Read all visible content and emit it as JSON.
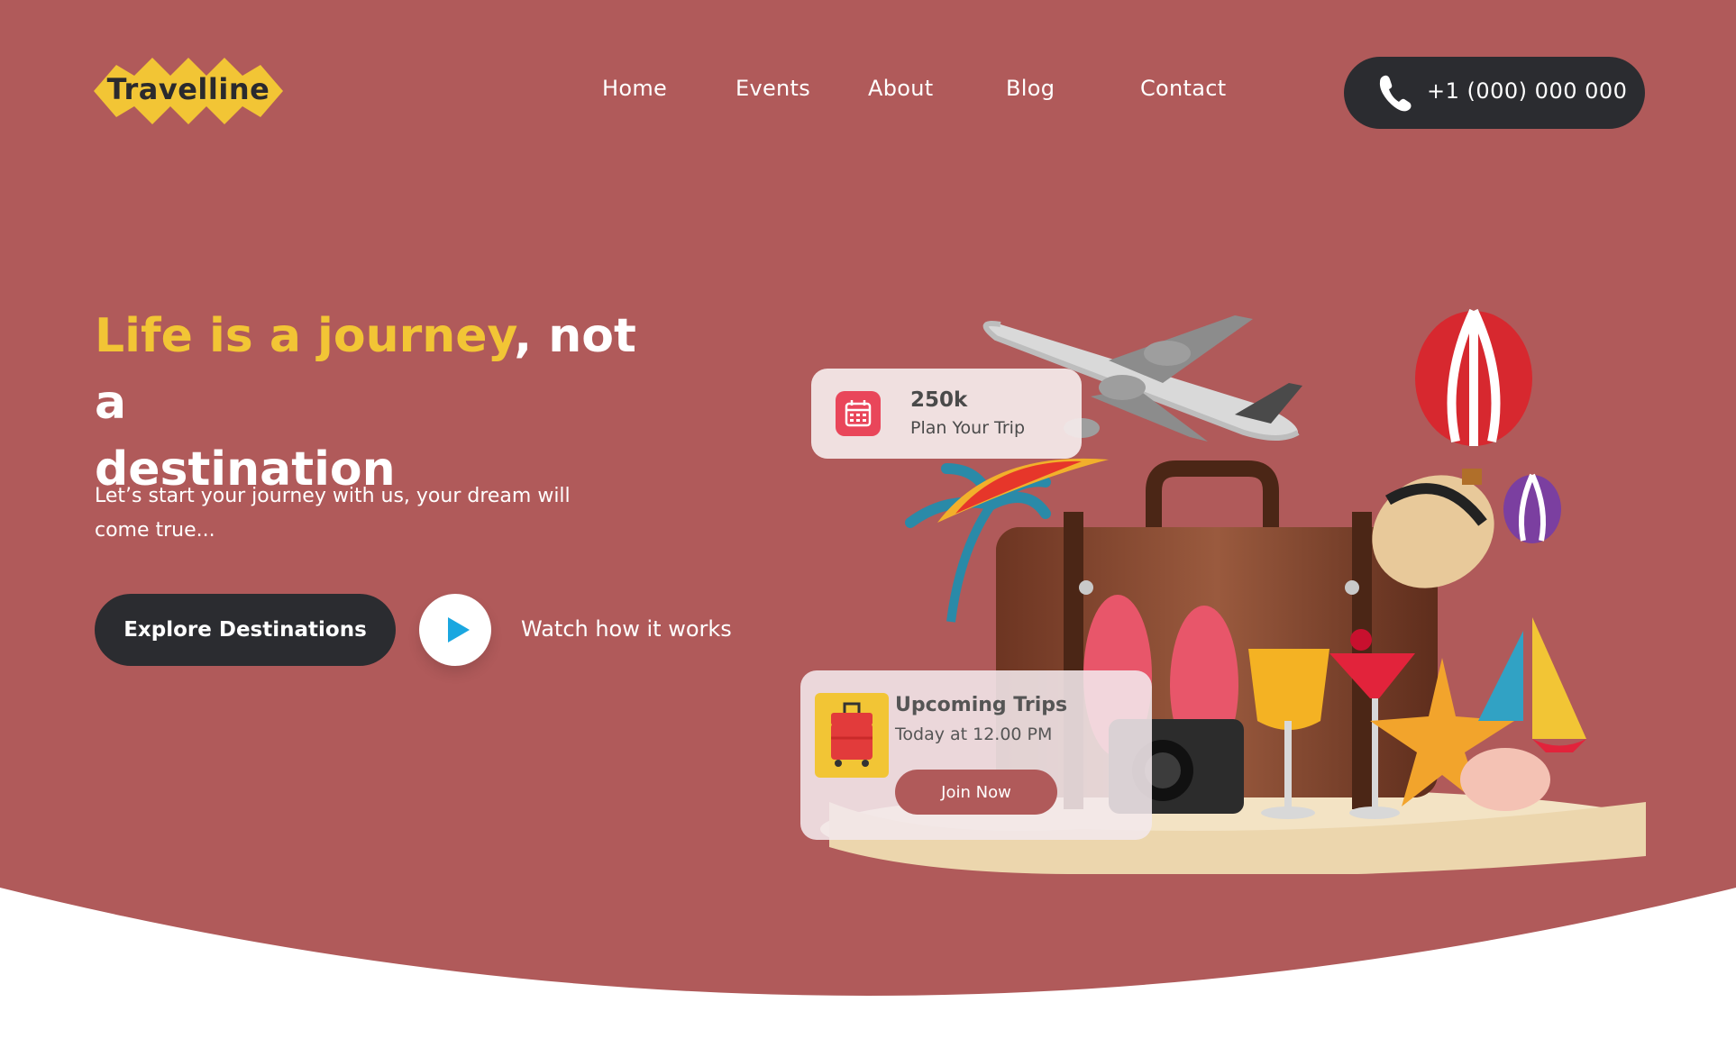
{
  "brand": {
    "logo_text": "Travelline"
  },
  "nav": {
    "items": [
      {
        "label": "Home"
      },
      {
        "label": "Events"
      },
      {
        "label": "About"
      },
      {
        "label": "Blog"
      },
      {
        "label": "Contact"
      }
    ],
    "phone": "+1 (000) 000 000"
  },
  "hero": {
    "headline_highlight": "Life is a journey",
    "headline_rest_1": ", not a",
    "headline_rest_2": "destination",
    "subtext": "Let’s start your journey with us, your dream will come true...",
    "explore_label": "Explore Destinations",
    "watch_label": "Watch how it works"
  },
  "cards": {
    "plan": {
      "count": "250k",
      "label": "Plan Your Trip",
      "icon": "calendar-icon"
    },
    "trips": {
      "title": "Upcoming Trips",
      "time": "Today at 12.00 PM",
      "button": "Join Now",
      "icon": "luggage-icon"
    }
  },
  "colors": {
    "hero_bg": "#b05a5a",
    "accent_yellow": "#f2c535",
    "dark": "#2b2c30",
    "play_blue": "#1aa7e0",
    "calendar_red": "#e9465a"
  }
}
